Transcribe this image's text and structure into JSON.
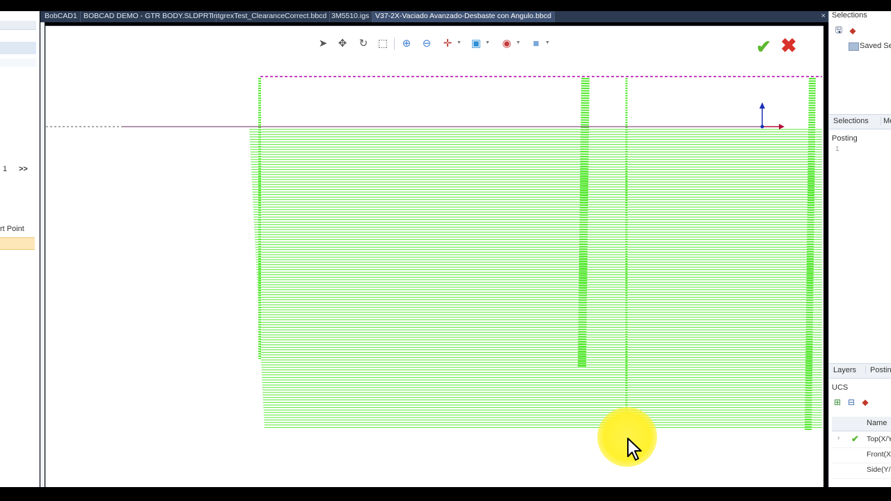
{
  "tabs": {
    "items": [
      {
        "label": "BobCAD1"
      },
      {
        "label": "BOBCAD DEMO - GTR BODY.SLDPRT"
      },
      {
        "label": "IntgrexTest_ClearanceCorrect.bbcd"
      },
      {
        "label": "3M5510.igs"
      },
      {
        "label": "V37-2X-Vaciado Avanzado-Desbaste con Angulo.bbcd"
      }
    ],
    "close_glyph": "×"
  },
  "left_panel": {
    "page_number": "1",
    "next_label": ">>",
    "start_point_label": "rt Point"
  },
  "toolbar": {
    "icons": [
      "select-arrow-icon",
      "pan-icon",
      "rotate-icon",
      "box-select-icon",
      "zoom-fit-icon",
      "zoom-icon",
      "move-axis-icon",
      "cube-view-icon",
      "visibility-icon",
      "shaded-icon"
    ]
  },
  "actions": {
    "ok_glyph": "✔",
    "cancel_glyph": "✖"
  },
  "right_panel": {
    "selections_title": "Selections",
    "saved_selections": "Saved Sel",
    "tabs_top": [
      "Selections",
      "Meas"
    ],
    "posting_label": "Posting",
    "posting_value": "1",
    "tabs_bottom": [
      "Layers",
      "Posting"
    ],
    "ucs_label": "UCS",
    "ucs_column": "Name",
    "ucs_rows": [
      {
        "name": "Top(X/Y",
        "active": true
      },
      {
        "name": "Front(X",
        "active": false
      },
      {
        "name": "Side(Y/",
        "active": false
      }
    ]
  },
  "colors": {
    "toolpath_green": "#55e830",
    "boundary_magenta": "#b000b0",
    "axis_blue": "#1a2fb5",
    "axis_red": "#b0103a",
    "tab_bar": "#2c3b52",
    "ok_green": "#5cb82e",
    "cancel_red": "#d8322b"
  }
}
